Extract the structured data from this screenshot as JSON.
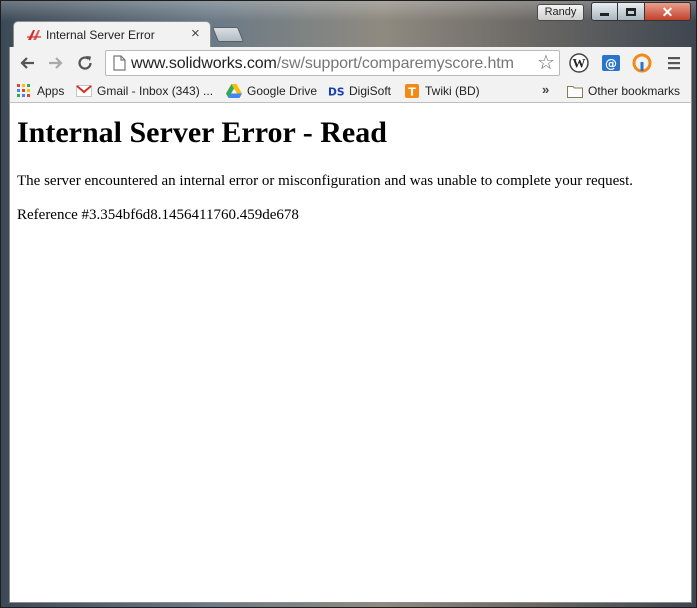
{
  "window": {
    "user_label": "Randy"
  },
  "tab": {
    "title": "Internal Server Error",
    "close_glyph": "×"
  },
  "toolbar": {
    "url_host": "www.solidworks.com",
    "url_path": "/sw/support/comparemyscore.htm"
  },
  "bookmarks": {
    "items": [
      {
        "label": "Apps",
        "icon": "apps-grid-icon"
      },
      {
        "label": "Gmail - Inbox (343) ...",
        "icon": "gmail-icon"
      },
      {
        "label": "Google Drive",
        "icon": "google-drive-icon"
      },
      {
        "label": "DigiSoft",
        "icon": "digisoft-icon"
      },
      {
        "label": "Twiki (BD)",
        "icon": "twiki-icon"
      }
    ],
    "overflow": "»",
    "other": "Other bookmarks"
  },
  "page": {
    "heading": "Internal Server Error - Read",
    "message": "The server encountered an internal error or misconfiguration and was unable to complete your request.",
    "reference": "Reference #3.354bf6d8.1456411760.459de678"
  },
  "colors": {
    "close_red": "#c2412b",
    "chrome_gray": "#f2f2f2"
  }
}
